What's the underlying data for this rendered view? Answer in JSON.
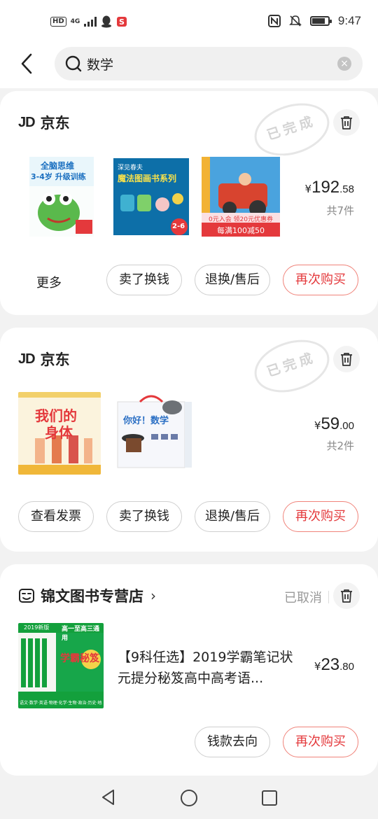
{
  "status_bar": {
    "hd": "HD",
    "network": "4G",
    "time": "9:47"
  },
  "search": {
    "query": "数学"
  },
  "orders": [
    {
      "shop": "京东",
      "status": "已完成",
      "price_yen": "¥",
      "price_int": "192",
      "price_dec": ".58",
      "count": "共7件",
      "more": "更多",
      "buttons": [
        "卖了换钱",
        "退换/售后",
        "再次购买"
      ],
      "product_images": [
        {
          "lines": [
            "全脑思维",
            "3-4岁 升级训练"
          ],
          "badge": ""
        },
        {
          "lines": [
            "深见春夫",
            "魔法图画书系列"
          ],
          "badge": "2-6"
        },
        {
          "lines": [
            "0元入会 领20元优惠券",
            "每满100减50"
          ],
          "badge": ""
        }
      ]
    },
    {
      "shop": "京东",
      "status": "已完成",
      "price_yen": "¥",
      "price_int": "59",
      "price_dec": ".00",
      "count": "共2件",
      "buttons": [
        "查看发票",
        "卖了换钱",
        "退换/售后",
        "再次购买"
      ],
      "product_images": [
        {
          "lines": [
            "我们的",
            "身体"
          ],
          "badge": ""
        },
        {
          "lines": [
            "你好！数学"
          ],
          "badge": ""
        }
      ]
    },
    {
      "shop": "锦文图书专营店",
      "shop_arrow": "›",
      "status": "已取消",
      "title": "【9科任选】2019学霸笔记状元提分秘笈高中高考语...",
      "price_yen": "¥",
      "price_int": "23",
      "price_dec": ".80",
      "buttons": [
        "钱款去向",
        "再次购买"
      ],
      "product_images": [
        {
          "lines": [
            "2019新版",
            "高一至高三通用",
            "学霸秘笈",
            "语文·数学·英语·物理·化学·生物·政治·历史·地理"
          ],
          "badge": ""
        }
      ]
    }
  ],
  "colors": {
    "accent_red": "#e4393c",
    "red_border": "#f0837a",
    "background": "#f2f2f2"
  }
}
